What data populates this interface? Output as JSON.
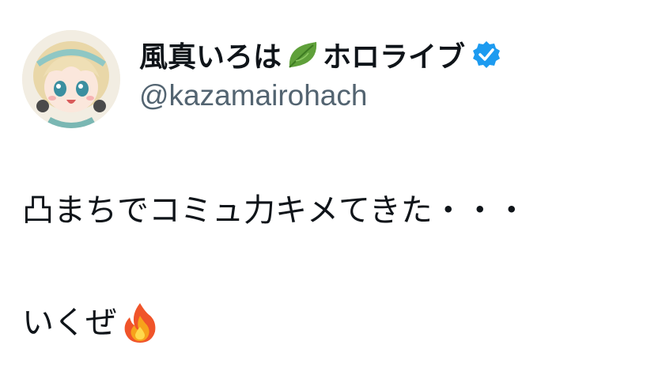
{
  "tweet": {
    "author": {
      "name_main": "風真いろは",
      "name_tail": "ホロライブ",
      "handle": "@kazamairohach",
      "leaf_icon": "leaf-icon",
      "verified_icon": "verified-badge-icon",
      "verified_color": "#1d9bf0"
    },
    "text": {
      "line1": "凸まちでコミュ力キメてきた・・・",
      "line2": "いくぜ",
      "emoji_icon": "fire-icon"
    }
  }
}
